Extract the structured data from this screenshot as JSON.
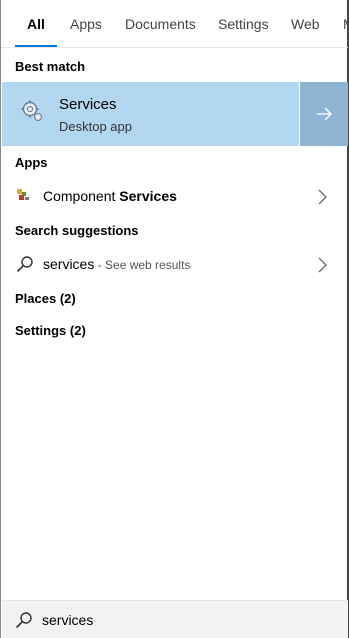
{
  "tabs": [
    {
      "label": "All"
    },
    {
      "label": "Apps"
    },
    {
      "label": "Documents"
    },
    {
      "label": "Settings"
    },
    {
      "label": "Web"
    },
    {
      "label": "M"
    }
  ],
  "sections": {
    "best_match": "Best match",
    "apps": "Apps",
    "search_suggestions": "Search suggestions",
    "places": "Places (2)",
    "settings": "Settings (2)"
  },
  "best_match": {
    "title": "Services",
    "subtitle": "Desktop app",
    "icon": "services-gear-icon"
  },
  "apps": [
    {
      "label_prefix": "Component ",
      "label_bold": "Services",
      "icon": "component-services-icon"
    }
  ],
  "suggestions": [
    {
      "query": "services",
      "hint": " - See web results",
      "icon": "search-icon"
    }
  ],
  "search": {
    "value": "services",
    "placeholder": ""
  },
  "colors": {
    "accent": "#0078d7",
    "selected_bg": "#b3d7f0",
    "selected_arrow_bg": "#8fb4d3"
  }
}
